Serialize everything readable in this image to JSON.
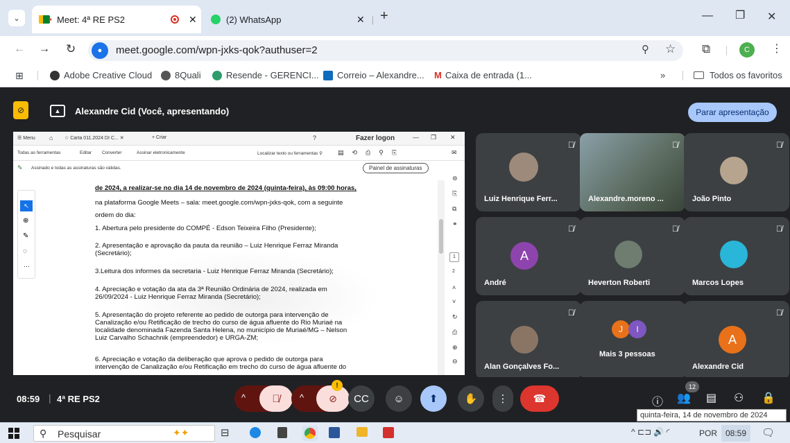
{
  "browser": {
    "tabs": [
      {
        "title": "Meet: 4ª RE PS2"
      },
      {
        "title": "(2) WhatsApp"
      }
    ],
    "url": "meet.google.com/wpn-jxks-qok?authuser=2",
    "profile_letter": "C",
    "bookmarks": [
      {
        "label": "Adobe Creative Cloud"
      },
      {
        "label": "8Quali"
      },
      {
        "label": "Resende - GERENCI..."
      },
      {
        "label": "Correio – Alexandre..."
      },
      {
        "label": "Caixa de entrada (1..."
      }
    ],
    "bookmarks_overflow": "»",
    "all_favorites": "Todos os favoritos"
  },
  "meet": {
    "presenter_label": "Alexandre Cid (Você, apresentando)",
    "stop_presenting": "Parar apresentação",
    "time": "08:59",
    "meeting_name": "4ª RE PS2",
    "participants_count": "12",
    "tiles": [
      {
        "name": "Luiz Henrique Ferr..."
      },
      {
        "name": "Alexandre.moreno ..."
      },
      {
        "name": "João Pinto"
      },
      {
        "name": "André",
        "initial": "A",
        "color": "#8e44ad"
      },
      {
        "name": "Heverton Roberti"
      },
      {
        "name": "Marcos Lopes"
      },
      {
        "name": "Alan Gonçalves Fo..."
      },
      {
        "name": "Mais 3 pessoas",
        "initials": [
          "J",
          "I"
        ]
      },
      {
        "name": "Alexandre Cid",
        "initial": "A",
        "color": "#e8711a"
      }
    ]
  },
  "doc": {
    "menu": "Menu",
    "tab_title": "Carta 011.2024 DI C...",
    "new_tab": "Criar",
    "login": "Fazer logon",
    "tools": [
      "Todas as ferramentas",
      "Editar",
      "Converter",
      "Assinar eletronicamente"
    ],
    "search_tools": "Localizar texto ou ferramentas",
    "signed_msg": "Assinado e todas as assinaturas são válidas.",
    "sign_panel": "Painel de assinaturas",
    "page_numbers": [
      "1",
      "2"
    ],
    "lines": [
      "de 2024, a realizar-se no dia 14 de novembro de 2024 (quinta-feira), às 09:00 horas,",
      "na plataforma Google Meets – sala: meet.google.com/wpn-jxks-qok, com a seguinte",
      "ordem do dia:",
      "1. Abertura pelo presidente do COMPÉ - Edson Teixeira Filho (Presidente);",
      "2. Apresentação e aprovação da pauta da reunião – Luiz Henrique Ferraz Miranda",
      "(Secretário);",
      "3.Leitura dos informes da secretaria - Luiz Henrique Ferraz Miranda (Secretário);",
      "4. Apreciação e votação da ata da 3ª Reunião Ordinária de 2024, realizada em",
      "26/09/2024 - Luiz Henrique Ferraz Miranda (Secretário);",
      "5. Apresentação do projeto referente ao pedido de outorga para intervenção de",
      "Canalização e/ou Retificação de trecho do curso de água afluente do Rio Muriaé na",
      "localidade denominada Fazenda Santa Helena, no município de Muriaé/MG – Nelson",
      "Luiz Carvalho Schachnik (empreendedor) e URGA-ZM;",
      "6. Apreciação e votação da deliberação que aprova o pedido de outorga para",
      "intervenção de Canalização e/ou Retificação em trecho do curso de água afluente do"
    ]
  },
  "taskbar": {
    "search_placeholder": "Pesquisar",
    "lang": "POR",
    "clock": "08:59",
    "tooltip": "quinta-feira, 14 de novembro de 2024"
  }
}
